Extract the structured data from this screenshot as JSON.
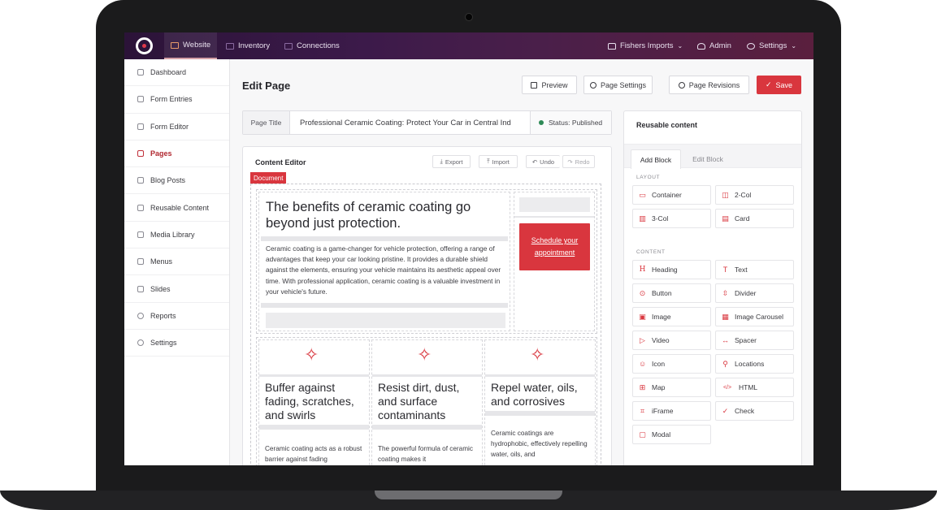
{
  "topbar": {
    "tabs": [
      {
        "label": "Website"
      },
      {
        "label": "Inventory"
      },
      {
        "label": "Connections"
      }
    ],
    "account": "Fishers Imports",
    "admin": "Admin",
    "settings": "Settings"
  },
  "sidebar": {
    "items": [
      {
        "label": "Dashboard"
      },
      {
        "label": "Form Entries"
      },
      {
        "label": "Form Editor"
      },
      {
        "label": "Pages"
      },
      {
        "label": "Blog Posts"
      },
      {
        "label": "Reusable Content"
      },
      {
        "label": "Media Library"
      },
      {
        "label": "Menus"
      },
      {
        "label": "Slides"
      },
      {
        "label": "Reports"
      },
      {
        "label": "Settings"
      }
    ],
    "active": "Pages"
  },
  "toolbar": {
    "page_title": "Edit Page",
    "preview": "Preview",
    "page_settings": "Page Settings",
    "page_revisions": "Page Revisions",
    "save": "Save"
  },
  "title_field": {
    "label": "Page Title",
    "value": "Professional Ceramic Coating: Protect Your Car in Central Ind",
    "status": "Status: Published"
  },
  "editor": {
    "heading": "Content Editor",
    "export": "Export",
    "import": "Import",
    "undo": "Undo",
    "redo": "Redo",
    "document_tag": "Document",
    "hero_heading": "The benefits of ceramic coating go beyond just protection.",
    "hero_text": "Ceramic coating is a game-changer for vehicle protection, offering a range of advantages that keep your car looking pristine. It provides a durable shield against the elements, ensuring your vehicle maintains its aesthetic appeal over time. With professional application, ceramic coating is a valuable investment in your vehicle's future.",
    "cta": "Schedule your appointment",
    "features": [
      {
        "heading": "Buffer against fading, scratches, and swirls",
        "text": "Ceramic coating acts as a robust barrier against fading"
      },
      {
        "heading": "Resist dirt, dust, and surface contaminants",
        "text": "The powerful formula of ceramic coating makes it"
      },
      {
        "heading": "Repel water, oils, and corrosives",
        "text": "Ceramic coatings are hydrophobic, effectively repelling water, oils, and"
      }
    ]
  },
  "panel": {
    "title": "Reusable content",
    "tabs": [
      {
        "label": "Add Block"
      },
      {
        "label": "Edit Block"
      }
    ],
    "layout_label": "LAYOUT",
    "layout_blocks": [
      {
        "label": "Container",
        "icon": "▭"
      },
      {
        "label": "2-Col",
        "icon": "◫"
      },
      {
        "label": "3-Col",
        "icon": "▥"
      },
      {
        "label": "Card",
        "icon": "▤"
      }
    ],
    "content_label": "CONTENT",
    "content_blocks": [
      {
        "label": "Heading",
        "icon": "H"
      },
      {
        "label": "Text",
        "icon": "T"
      },
      {
        "label": "Button",
        "icon": "⊙"
      },
      {
        "label": "Divider",
        "icon": "⇳"
      },
      {
        "label": "Image",
        "icon": "▣"
      },
      {
        "label": "Image Carousel",
        "icon": "▦"
      },
      {
        "label": "Video",
        "icon": "▷"
      },
      {
        "label": "Spacer",
        "icon": "↔"
      },
      {
        "label": "Icon",
        "icon": "☺"
      },
      {
        "label": "Locations",
        "icon": "⚲"
      },
      {
        "label": "Map",
        "icon": "⊞"
      },
      {
        "label": "HTML",
        "icon": "</>"
      },
      {
        "label": "iFrame",
        "icon": "⌗"
      },
      {
        "label": "Check",
        "icon": "✓"
      },
      {
        "label": "Modal",
        "icon": "▢"
      }
    ]
  },
  "colors": {
    "accent": "#d9363e",
    "topbar": "#3c1a4a",
    "status": "#2e8a57"
  }
}
